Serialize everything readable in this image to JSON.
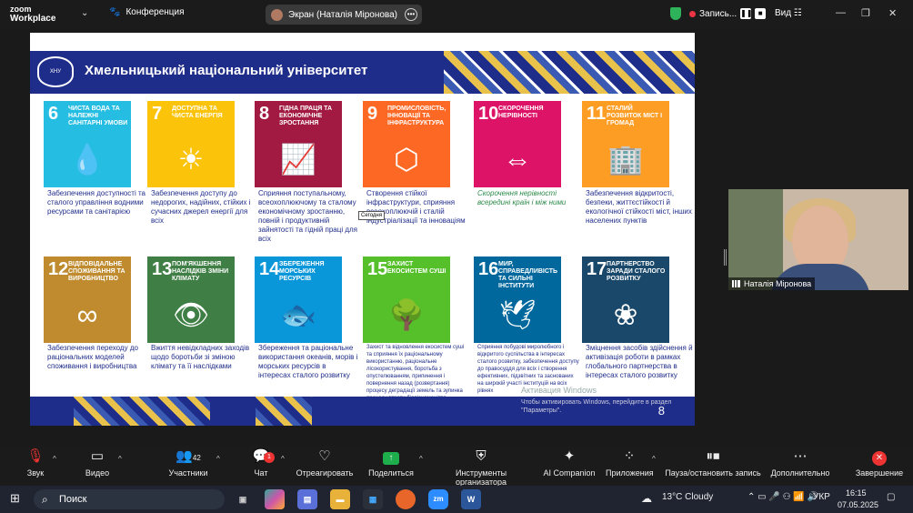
{
  "app": {
    "logo_line1": "zoom",
    "logo_line2": "Workplace"
  },
  "topbar": {
    "conference_label": "Конференция",
    "screen_label": "Экран (Наталія Міронова)",
    "recording_label": "Запись...",
    "view_label": "Вид"
  },
  "slide": {
    "university_title": "Хмельницький національний університет",
    "logo_text": "ХНУ",
    "page_number": "8",
    "tooltip": "Сегодня",
    "watermark_title": "Активация Windows",
    "watermark_text": "Чтобы активировать Windows, перейдите в раздел \"Параметры\".",
    "goals": [
      {
        "num": "6",
        "title": "Чиста вода та належні санітарні умови",
        "color": "#26bde2",
        "icon": "💧",
        "desc": "Забезпечення доступності та сталого управління водними ресурсами та санітарією"
      },
      {
        "num": "7",
        "title": "Доступна та чиста енергія",
        "color": "#fcc30b",
        "icon": "☀",
        "desc": "Забезпечення доступу до недорогих, надійних, стійких і сучасних джерел енергії для всіх"
      },
      {
        "num": "8",
        "title": "Гідна праця та економічне зростання",
        "color": "#a21942",
        "icon": "📈",
        "desc": "Сприяння поступальному, всеохоплюючому та сталому економічному зростанню, повній і продуктивній зайнятості та гідній праці для всіх"
      },
      {
        "num": "9",
        "title": "Промисловість, інновації та інфраструктура",
        "color": "#fd6925",
        "icon": "⬡",
        "desc": "Створення стійкої інфраструктури, сприяння всеохоплюючій і сталій індустріалізації та інноваціям"
      },
      {
        "num": "10",
        "title": "Скорочення нерівності",
        "color": "#dd1367",
        "icon": "⇔",
        "desc": "Скорочення нерівності всередині країн і між ними"
      },
      {
        "num": "11",
        "title": "Сталий розвиток міст і громад",
        "color": "#fd9d24",
        "icon": "🏢",
        "desc": "Забезпечення відкритості, безпеки, життєстійкості й екологічної стійкості міст, інших населених пунктів"
      },
      {
        "num": "12",
        "title": "Відповідальне споживання та виробництво",
        "color": "#bf8b2e",
        "icon": "∞",
        "desc": "Забезпечення переходу до раціональних моделей споживання і виробництва"
      },
      {
        "num": "13",
        "title": "Пом'якшення наслідків зміни клімату",
        "color": "#3f7e44",
        "icon": "👁",
        "desc": "Вжиття невідкладних заходів щодо боротьби зі зміною клімату та її наслідками"
      },
      {
        "num": "14",
        "title": "Збереження морських ресурсів",
        "color": "#0a97d9",
        "icon": "🐟",
        "desc": "Збереження та раціональне використання океанів, морів і морських ресурсів в інтересах сталого розвитку"
      },
      {
        "num": "15",
        "title": "Захист екосистем суші",
        "color": "#56c02b",
        "icon": "🌳",
        "desc": "Захист та відновлення екосистем суші та сприяння їх раціональному використанню, раціональне лісокористування, боротьба з опустелюванням, припинення і повернення назад (розвертання) процесу деградації земель та зупинка процесу втрати біорізноманіття"
      },
      {
        "num": "16",
        "title": "Мир, справедливість та сильні інститути",
        "color": "#00689d",
        "icon": "🕊",
        "desc": "Сприяння побудові миролюбного і відкритого суспільства в інтересах сталого розвитку, забезпечення доступу до правосуддя для всіх і створення ефективних, підзвітних та заснованих на широкій участі інституцій на всіх рівнях"
      },
      {
        "num": "17",
        "title": "Партнерство заради сталого розвитку",
        "color": "#19486a",
        "icon": "❀",
        "desc": "Зміцнення засобів здійснення й активізація роботи в рамках глобального партнерства в інтересах сталого розвитку"
      }
    ]
  },
  "webcam": {
    "name": "Наталія Міронова"
  },
  "controls": {
    "audio": "Звук",
    "video": "Видео",
    "participants": "Участники",
    "participants_count": "42",
    "chat": "Чат",
    "chat_badge": "1",
    "react": "Отреагировать",
    "share": "Поделиться",
    "host_tools": "Инструменты организатора",
    "ai": "AI Companion",
    "apps": "Приложения",
    "pause": "Пауза/остановить запись",
    "more": "Дополнительно",
    "end": "Завершение"
  },
  "taskbar": {
    "search_placeholder": "Поиск",
    "weather": "13°C  Cloudy",
    "lang": "УКР",
    "time": "16:15",
    "date": "07.05.2025"
  }
}
